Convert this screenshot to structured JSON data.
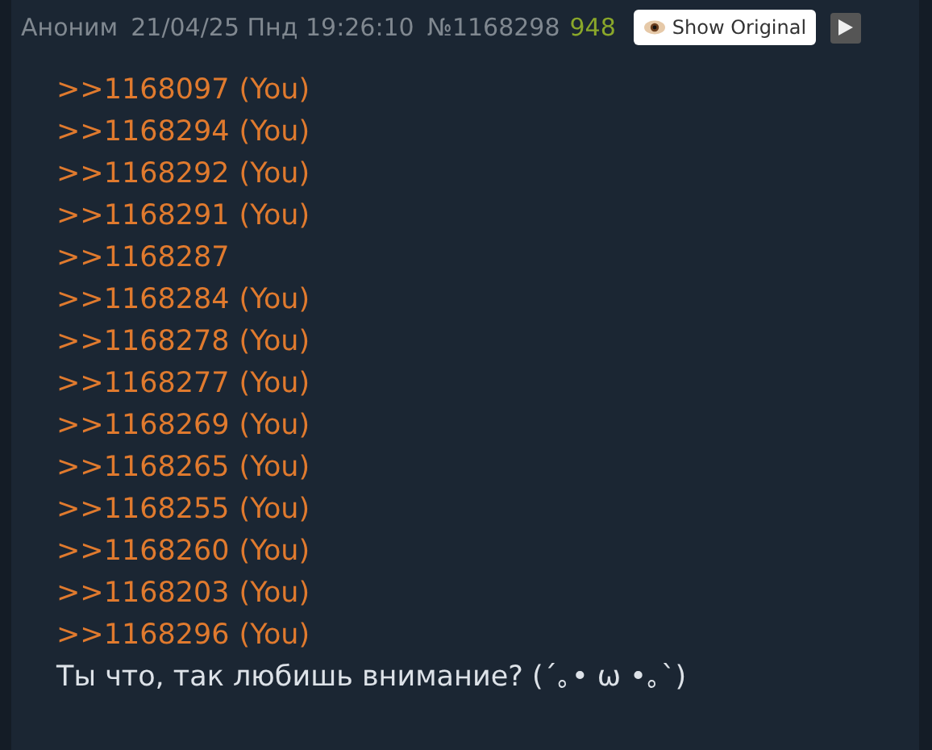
{
  "post": {
    "author": "Аноним",
    "date": "21/04/25 Пнд 19:26:10",
    "number": "№1168298",
    "count": "948",
    "show_original": "Show Original"
  },
  "replies": [
    {
      "link": ">>1168097",
      "you": "(You)"
    },
    {
      "link": ">>1168294",
      "you": "(You)"
    },
    {
      "link": ">>1168292",
      "you": "(You)"
    },
    {
      "link": ">>1168291",
      "you": "(You)"
    },
    {
      "link": ">>1168287"
    },
    {
      "link": ">>1168284",
      "you": "(You)"
    },
    {
      "link": ">>1168278",
      "you": "(You)"
    },
    {
      "link": ">>1168277",
      "you": "(You)"
    },
    {
      "link": ">>1168269",
      "you": "(You)"
    },
    {
      "link": ">>1168265",
      "you": "(You)"
    },
    {
      "link": ">>1168255",
      "you": "(You)"
    },
    {
      "link": ">>1168260",
      "you": "(You)"
    },
    {
      "link": ">>1168203",
      "you": "(You)"
    },
    {
      "link": ">>1168296",
      "you": "(You)"
    }
  ],
  "message": "Ты что, так любишь внимание? (´｡• ω •｡`)"
}
